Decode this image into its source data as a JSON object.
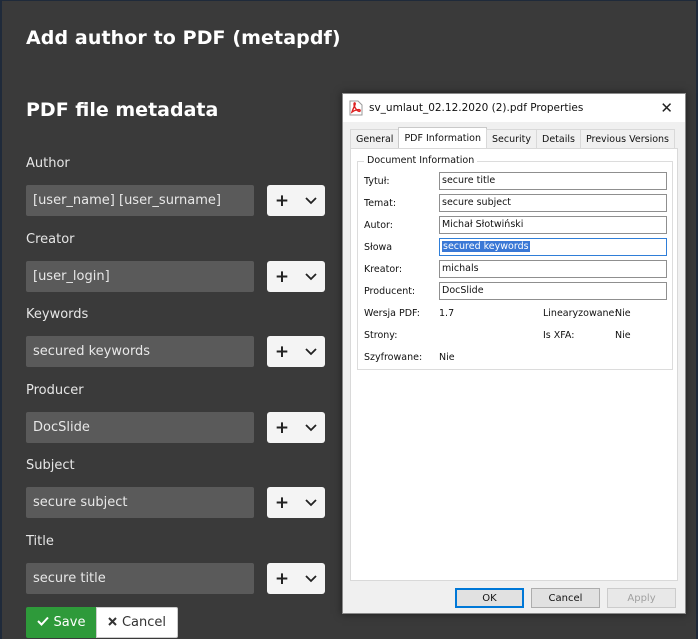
{
  "page": {
    "title": "Add author to PDF (metapdf)",
    "section_title": "PDF file metadata"
  },
  "fields": [
    {
      "label": "Author",
      "value": "[user_name] [user_surname]"
    },
    {
      "label": "Creator",
      "value": "[user_login]"
    },
    {
      "label": "Keywords",
      "value": "secured keywords"
    },
    {
      "label": "Producer",
      "value": "DocSlide"
    },
    {
      "label": "Subject",
      "value": "secure subject"
    },
    {
      "label": "Title",
      "value": "secure title"
    }
  ],
  "field_actions": {
    "plus_label": "+"
  },
  "buttons": {
    "save": "Save",
    "cancel": "Cancel"
  },
  "dialog": {
    "title": "sv_umlaut_02.12.2020 (2).pdf Properties",
    "close": "✕",
    "tabs": [
      "General",
      "PDF Information",
      "Security",
      "Details",
      "Previous Versions"
    ],
    "active_tab": "PDF Information",
    "group_label": "Document Information",
    "properties": [
      {
        "label": "Tytuł:",
        "value": "secure title"
      },
      {
        "label": "Temat:",
        "value": "secure subject"
      },
      {
        "label": "Autor:",
        "value": "Michał Słotwiński"
      },
      {
        "label": "Słowa",
        "value": "secured keywords"
      },
      {
        "label": "Kreator:",
        "value": "michals"
      },
      {
        "label": "Producent:",
        "value": "DocSlide"
      }
    ],
    "wersja_label": "Wersja PDF:",
    "wersja_value": "1.7",
    "linear_label": "Linearyzowane:",
    "linear_value": "Nie",
    "strony_label": "Strony:",
    "xfa_label": "Is XFA:",
    "xfa_value": "Nie",
    "szyfr_label": "Szyfrowane:",
    "szyfr_value": "Nie",
    "ok": "OK",
    "cancel": "Cancel",
    "apply": "Apply"
  },
  "colors": {
    "background": "#3a3a3a",
    "input_bg": "#5a5a5a",
    "save_green": "#2e9a3a",
    "selection_blue": "#3a78d6"
  }
}
